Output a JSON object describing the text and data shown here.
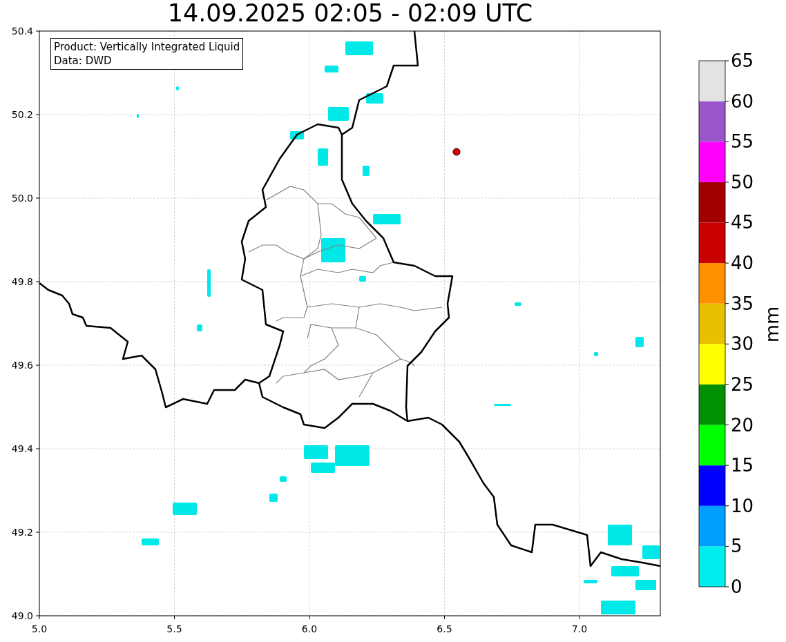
{
  "title": "14.09.2025 02:05 - 02:09 UTC",
  "info_box": {
    "lines": [
      "Product: Vertically Integrated Liquid",
      "Data: DWD"
    ]
  },
  "map": {
    "xticks": [
      "5.0",
      "5.5",
      "6.0",
      "6.5",
      "7.0"
    ],
    "yticks": [
      "50.4",
      "50.2",
      "50.0",
      "49.8",
      "49.6",
      "49.4",
      "49.2",
      "49.0"
    ]
  },
  "colorbar": {
    "label": "mm",
    "ticks": [
      "65",
      "60",
      "55",
      "50",
      "45",
      "40",
      "35",
      "30",
      "25",
      "20",
      "15",
      "10",
      "5",
      "0"
    ],
    "segments": [
      {
        "color": "#00eeee"
      },
      {
        "color": "#009eff"
      },
      {
        "color": "#0000ff"
      },
      {
        "color": "#00ff00"
      },
      {
        "color": "#009000"
      },
      {
        "color": "#ffff00"
      },
      {
        "color": "#e7c000"
      },
      {
        "color": "#ff9000"
      },
      {
        "color": "#c80000"
      },
      {
        "color": "#a00000"
      },
      {
        "color": "#ff00ff"
      },
      {
        "color": "#9955c9"
      },
      {
        "color": "#e3e3e3"
      }
    ]
  }
}
